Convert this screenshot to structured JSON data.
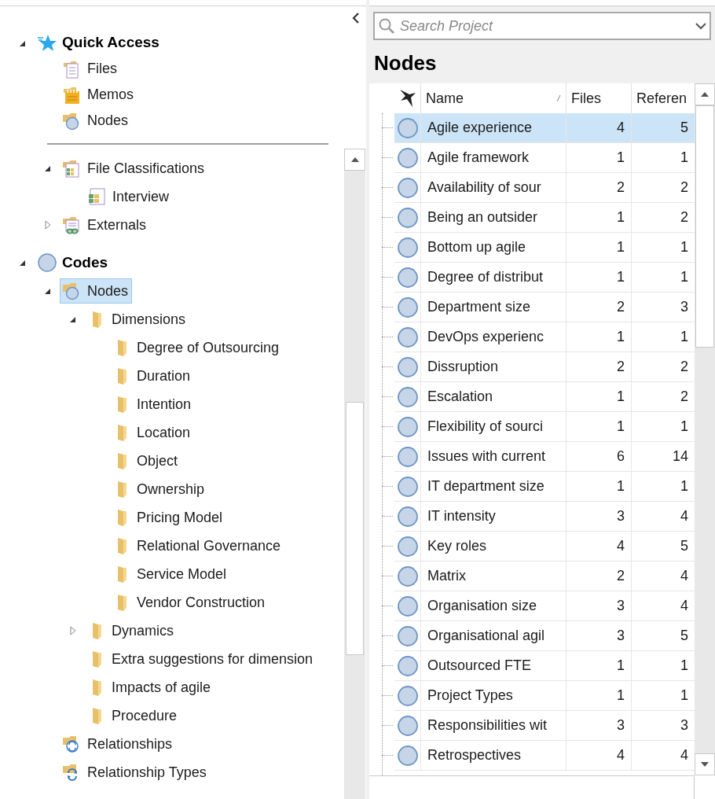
{
  "navigator": {
    "groups": [
      {
        "kind": "pinned",
        "items": [
          {
            "label": "Quick Access",
            "kind": "star",
            "bold": true,
            "expanded": true,
            "selected": false,
            "children": [
              {
                "label": "Files",
                "kind": "files",
                "selected": false
              },
              {
                "label": "Memos",
                "kind": "memos",
                "selected": false
              },
              {
                "label": "Nodes",
                "kind": "nodes",
                "selected": false
              }
            ]
          }
        ]
      },
      {
        "kind": "divided",
        "items": [
          {
            "label": "File Classifications",
            "kind": "classifications",
            "expanded": true,
            "selected": false,
            "children": [
              {
                "label": "Interview",
                "kind": "classification",
                "selected": false
              }
            ]
          },
          {
            "label": "Externals",
            "kind": "externals",
            "expanded": false,
            "selected": false
          }
        ]
      },
      {
        "kind": "plain",
        "items": [
          {
            "label": "Codes",
            "kind": "code",
            "bold": true,
            "expanded": true,
            "selected": false,
            "children": [
              {
                "label": "Nodes",
                "kind": "nodes",
                "expanded": true,
                "selected": true,
                "children": [
                  {
                    "label": "Dimensions",
                    "kind": "folder",
                    "expanded": true,
                    "selected": false,
                    "children": [
                      {
                        "label": "Degree of Outsourcing",
                        "kind": "folder",
                        "selected": false
                      },
                      {
                        "label": "Duration",
                        "kind": "folder",
                        "selected": false
                      },
                      {
                        "label": "Intention",
                        "kind": "folder",
                        "selected": false
                      },
                      {
                        "label": "Location",
                        "kind": "folder",
                        "selected": false
                      },
                      {
                        "label": "Object",
                        "kind": "folder",
                        "selected": false
                      },
                      {
                        "label": "Ownership",
                        "kind": "folder",
                        "selected": false
                      },
                      {
                        "label": "Pricing Model",
                        "kind": "folder",
                        "selected": false
                      },
                      {
                        "label": "Relational Governance",
                        "kind": "folder",
                        "selected": false
                      },
                      {
                        "label": "Service Model",
                        "kind": "folder",
                        "selected": false
                      },
                      {
                        "label": "Vendor Construction",
                        "kind": "folder",
                        "selected": false
                      }
                    ]
                  },
                  {
                    "label": "Dynamics",
                    "kind": "folder",
                    "expanded": false,
                    "selected": false
                  },
                  {
                    "label": "Extra suggestions for dimension",
                    "kind": "folder",
                    "selected": false
                  },
                  {
                    "label": "Impacts of agile",
                    "kind": "folder",
                    "selected": false
                  },
                  {
                    "label": "Procedure",
                    "kind": "folder",
                    "selected": false
                  }
                ]
              },
              {
                "label": "Relationships",
                "kind": "relationships",
                "selected": false
              },
              {
                "label": "Relationship Types",
                "kind": "relationship-types",
                "selected": false
              }
            ]
          }
        ]
      }
    ]
  },
  "search": {
    "placeholder": "Search Project"
  },
  "list_view": {
    "title": "Nodes",
    "columns": [
      "Name",
      "Files",
      "Referen"
    ],
    "rows": [
      {
        "name": "Agile experience",
        "files": "4",
        "references": "5",
        "selected": true
      },
      {
        "name": "Agile framework",
        "files": "1",
        "references": "1",
        "selected": false
      },
      {
        "name": "Availability of sour",
        "files": "2",
        "references": "2",
        "selected": false
      },
      {
        "name": "Being an outsider",
        "files": "1",
        "references": "2",
        "selected": false
      },
      {
        "name": "Bottom up agile",
        "files": "1",
        "references": "1",
        "selected": false
      },
      {
        "name": "Degree of distribut",
        "files": "1",
        "references": "1",
        "selected": false
      },
      {
        "name": "Department size",
        "files": "2",
        "references": "3",
        "selected": false
      },
      {
        "name": "DevOps experienc",
        "files": "1",
        "references": "1",
        "selected": false
      },
      {
        "name": "Dissruption",
        "files": "2",
        "references": "2",
        "selected": false
      },
      {
        "name": "Escalation",
        "files": "1",
        "references": "2",
        "selected": false
      },
      {
        "name": "Flexibility of sourci",
        "files": "1",
        "references": "1",
        "selected": false
      },
      {
        "name": "Issues with current",
        "files": "6",
        "references": "14",
        "selected": false
      },
      {
        "name": "IT department size",
        "files": "1",
        "references": "1",
        "selected": false
      },
      {
        "name": "IT intensity",
        "files": "3",
        "references": "4",
        "selected": false
      },
      {
        "name": "Key roles",
        "files": "4",
        "references": "5",
        "selected": false
      },
      {
        "name": "Matrix",
        "files": "2",
        "references": "4",
        "selected": false
      },
      {
        "name": "Organisation size",
        "files": "3",
        "references": "4",
        "selected": false
      },
      {
        "name": "Organisational agil",
        "files": "3",
        "references": "5",
        "selected": false
      },
      {
        "name": "Outsourced FTE",
        "files": "1",
        "references": "1",
        "selected": false
      },
      {
        "name": "Project Types",
        "files": "1",
        "references": "1",
        "selected": false
      },
      {
        "name": "Responsibilities wit",
        "files": "3",
        "references": "3",
        "selected": false
      },
      {
        "name": "Retrospectives",
        "files": "4",
        "references": "4",
        "selected": false
      }
    ]
  }
}
